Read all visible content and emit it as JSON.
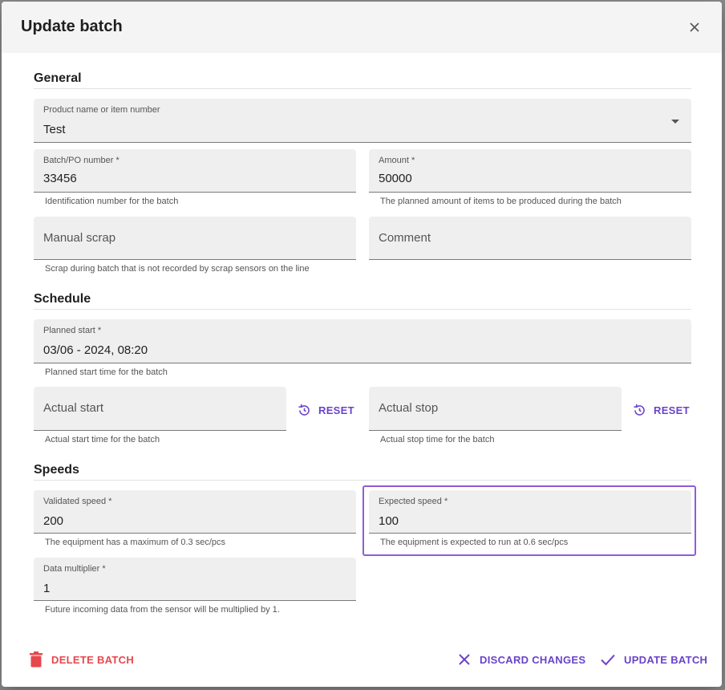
{
  "dialog": {
    "title": "Update batch"
  },
  "general": {
    "heading": "General",
    "product": {
      "label": "Product name or item number",
      "value": "Test"
    },
    "batch": {
      "label": "Batch/PO number *",
      "value": "33456",
      "helper": "Identification number for the batch"
    },
    "amount": {
      "label": "Amount *",
      "value": "50000",
      "helper": "The planned amount of items to be produced during the batch"
    },
    "manual_scrap": {
      "placeholder": "Manual scrap",
      "helper": "Scrap during batch that is not recorded by scrap sensors on the line"
    },
    "comment": {
      "placeholder": "Comment"
    }
  },
  "schedule": {
    "heading": "Schedule",
    "planned_start": {
      "label": "Planned start *",
      "value": "03/06 - 2024, 08:20",
      "helper": "Planned start time for the batch"
    },
    "actual_start": {
      "placeholder": "Actual start",
      "helper": "Actual start time for the batch",
      "reset_label": "RESET"
    },
    "actual_stop": {
      "placeholder": "Actual stop",
      "helper": "Actual stop time for the batch",
      "reset_label": "RESET"
    }
  },
  "speeds": {
    "heading": "Speeds",
    "validated": {
      "label": "Validated speed *",
      "value": "200",
      "helper": "The equipment has a maximum of 0.3 sec/pcs"
    },
    "expected": {
      "label": "Expected speed *",
      "value": "100",
      "helper": "The equipment is expected to run at 0.6 sec/pcs"
    },
    "multiplier": {
      "label": "Data multiplier *",
      "value": "1",
      "helper": "Future incoming data from the sensor will be multiplied by 1."
    }
  },
  "actions": {
    "delete_label": "DELETE BATCH",
    "discard_label": "DISCARD CHANGES",
    "update_label": "UPDATE BATCH"
  },
  "colors": {
    "accent": "#6a43c9",
    "danger": "#e5484d",
    "highlight": "#8e5cd9",
    "field_bg": "#efefef"
  },
  "icons": {
    "close": "close-icon",
    "dropdown": "chevron-down-icon",
    "reset": "history-icon",
    "delete": "trash-icon",
    "discard": "x-icon",
    "update": "check-icon"
  }
}
